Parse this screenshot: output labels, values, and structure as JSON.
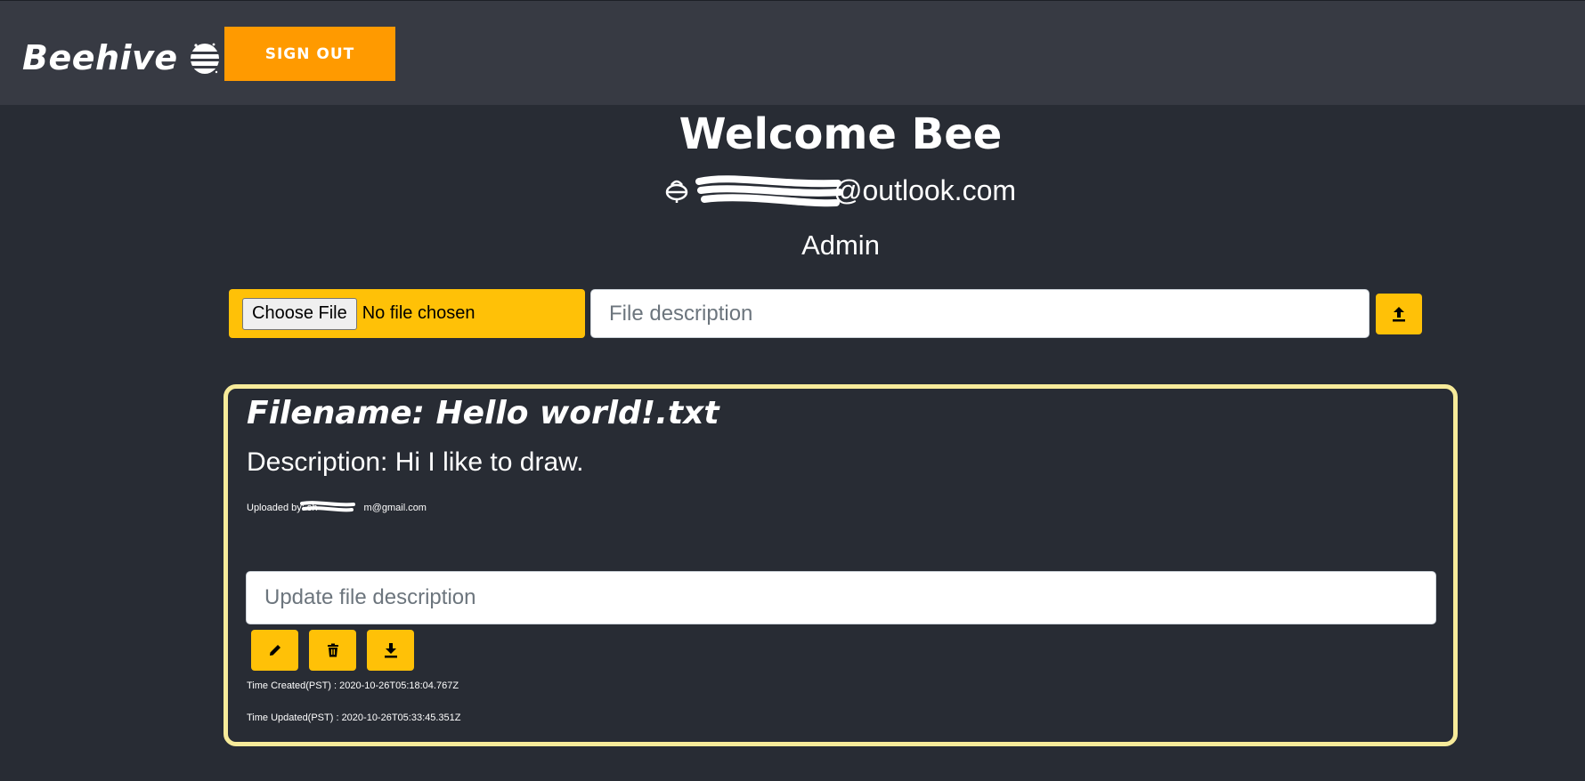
{
  "app": {
    "brand": "Beehive",
    "signout_label": "SIGN OUT"
  },
  "header": {
    "welcome": "Welcome Bee",
    "email_visible": "@outlook.com",
    "role": "Admin"
  },
  "upload": {
    "choose_file_label": "Choose File",
    "no_file_text": "No file chosen",
    "description_placeholder": "File description"
  },
  "file": {
    "filename_line": "Filename: Hello world!.txt",
    "description_line": "Description: Hi I like to draw.",
    "uploaded_by_prefix": "Uploaded by: ",
    "uploaded_by_visible": "sh",
    "uploaded_by_suffix": "m@gmail.com",
    "update_placeholder": "Update file description",
    "time_created": "Time Created(PST) : 2020-10-26T05:18:04.767Z",
    "time_updated": "Time Updated(PST) : 2020-10-26T05:33:45.351Z"
  },
  "colors": {
    "background": "#282c34",
    "navbar": "#373a43",
    "signout": "#ff9a00",
    "accent": "#ffc107",
    "card_border": "#f7eb9a"
  },
  "icons": {
    "brand": "beehive-icon",
    "email": "bee-icon",
    "upload": "upload-arrow-icon",
    "edit": "pencil-icon",
    "delete": "trash-icon",
    "download": "download-arrow-icon"
  }
}
